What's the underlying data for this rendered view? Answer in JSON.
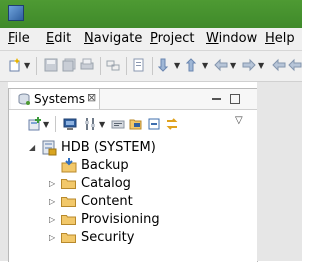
{
  "menu": [
    {
      "mnemonic": "F",
      "rest": "ile"
    },
    {
      "mnemonic": "E",
      "rest": "dit"
    },
    {
      "mnemonic": "N",
      "rest": "avigate"
    },
    {
      "mnemonic": "P",
      "rest": "roject"
    },
    {
      "mnemonic": "W",
      "rest": "indow"
    },
    {
      "mnemonic": "H",
      "rest": "elp"
    }
  ],
  "view": {
    "tab_title": "Systems",
    "close_glyph": "⊠"
  },
  "tree": {
    "root": "HDB (SYSTEM)",
    "children": [
      "Backup",
      "Catalog",
      "Content",
      "Provisioning",
      "Security"
    ]
  },
  "colors": {
    "titlebar": "#4e9a33",
    "folder": "#f2c86a"
  }
}
